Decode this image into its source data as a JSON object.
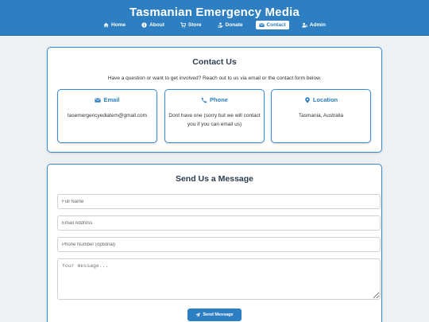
{
  "header": {
    "title": "Tasmanian Emergency Media",
    "nav": [
      {
        "label": "Home",
        "icon": "home-icon",
        "active": false
      },
      {
        "label": "About",
        "icon": "info-icon",
        "active": false
      },
      {
        "label": "Store",
        "icon": "cart-icon",
        "active": false
      },
      {
        "label": "Donate",
        "icon": "donate-icon",
        "active": false
      },
      {
        "label": "Contact",
        "icon": "envelope-icon",
        "active": true
      },
      {
        "label": "Admin",
        "icon": "admin-icon",
        "active": false
      }
    ]
  },
  "contact": {
    "title": "Contact Us",
    "intro": "Have a question or want to get involved? Reach out to us via email or the contact form below.",
    "email": {
      "heading": "Email",
      "icon": "envelope-icon",
      "value": "tasemergencyediatem@gmail.com"
    },
    "phone": {
      "heading": "Phone",
      "icon": "phone-icon",
      "value": "Dont have one (sorry but we will contact you if you can email us)"
    },
    "location": {
      "heading": "Location",
      "icon": "map-marker-icon",
      "value": "Tasmania, Australia"
    }
  },
  "message_form": {
    "title": "Send Us a Message",
    "full_name_placeholder": "Full Name",
    "email_placeholder": "Email Address",
    "phone_placeholder": "Phone Number (optional)",
    "message_placeholder": "Your message...",
    "send_label": "Send Message"
  },
  "colors": {
    "primary": "#2d7fc1",
    "page_background": "#eef1f4",
    "card_border": "#3a8ad0",
    "heading_text": "#2c3e50"
  }
}
